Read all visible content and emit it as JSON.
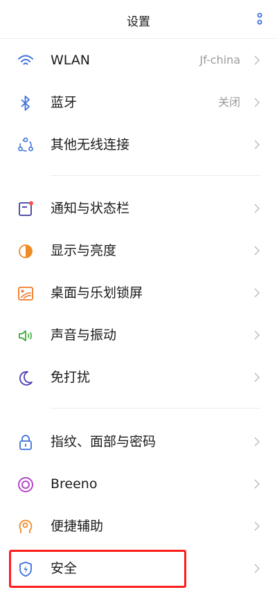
{
  "header": {
    "title": "设置",
    "menu_icon": "vertical-dots-icon"
  },
  "items": [
    {
      "label": "WLAN",
      "value": "Jf-china",
      "icon": "wifi-icon",
      "color": "#3b6fdc"
    },
    {
      "label": "蓝牙",
      "value": "关闭",
      "icon": "bluetooth-icon",
      "color": "#3b6fdc"
    },
    {
      "label": "其他无线连接",
      "icon": "connections-icon",
      "color": "#3b6fdc"
    },
    {
      "label": "通知与状态栏",
      "icon": "notification-icon",
      "color": "#3b3b9a"
    },
    {
      "label": "显示与亮度",
      "icon": "brightness-icon",
      "color": "#f08a24"
    },
    {
      "label": "桌面与乐划锁屏",
      "icon": "wallpaper-icon",
      "color": "#f07a2a"
    },
    {
      "label": "声音与振动",
      "icon": "sound-icon",
      "color": "#3aaa35"
    },
    {
      "label": "免打扰",
      "icon": "moon-icon",
      "color": "#4a3fb2"
    },
    {
      "label": "指纹、面部与密码",
      "icon": "lock-icon",
      "color": "#3b6fdc"
    },
    {
      "label": "Breeno",
      "icon": "breeno-icon",
      "color": "#b546c8"
    },
    {
      "label": "便捷辅助",
      "icon": "assist-icon",
      "color": "#f08a24"
    },
    {
      "label": "安全",
      "icon": "shield-icon",
      "color": "#3b6fdc",
      "highlighted": true
    }
  ],
  "highlight_color": "#ff1d1d"
}
